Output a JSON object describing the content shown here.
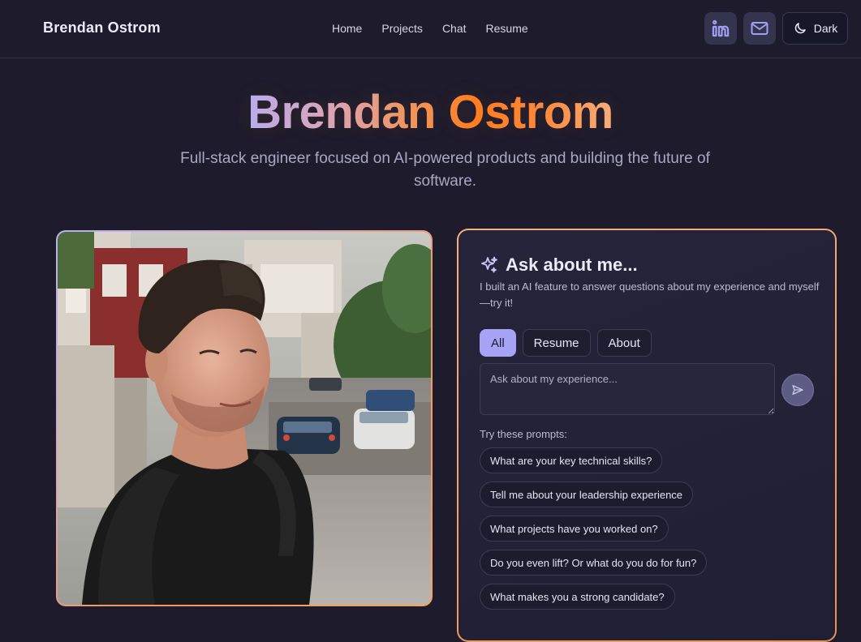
{
  "nav": {
    "brand": "Brendan Ostrom",
    "links": [
      "Home",
      "Projects",
      "Chat",
      "Resume"
    ],
    "linkedin_icon": "linkedin-icon",
    "mail_icon": "mail-icon",
    "theme_label": "Dark",
    "theme_icon": "moon-icon"
  },
  "hero": {
    "title": "Brendan Ostrom",
    "subtitle": "Full-stack engineer focused on AI-powered products and building the future of software."
  },
  "chat": {
    "title": "Ask about me...",
    "title_icon": "sparkles-icon",
    "description": "I built an AI feature to answer questions about my experience and myself—try it!",
    "filters": [
      "All",
      "Resume",
      "About"
    ],
    "active_filter": "All",
    "input_placeholder": "Ask about my experience...",
    "input_value": "",
    "send_icon": "send-icon",
    "prompts_label": "Try these prompts:",
    "prompts": [
      "What are your key technical skills?",
      "Tell me about your leadership experience",
      "What projects have you worked on?",
      "Do you even lift? Or what do you do for fun?",
      "What makes you a strong candidate?"
    ]
  },
  "colors": {
    "background": "#1d1b2c",
    "accent_purple": "#a7a4f6",
    "accent_orange": "#ff7d20",
    "card_border": "#f2a366"
  }
}
